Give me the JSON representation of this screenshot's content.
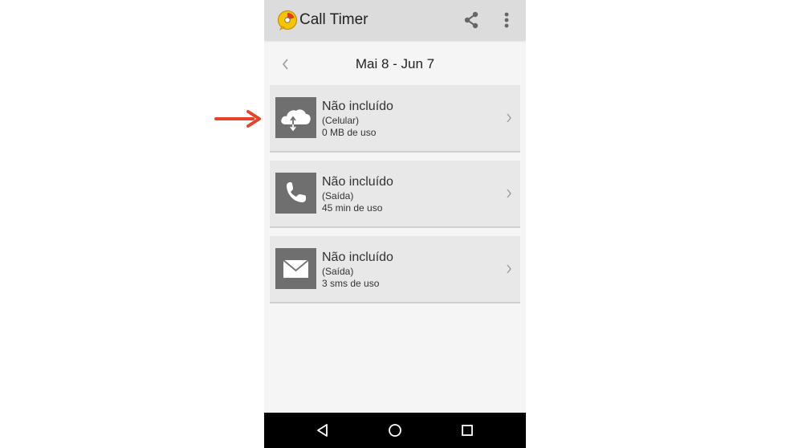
{
  "app": {
    "title": "Call Timer",
    "icon": "call-timer-logo-icon",
    "share_icon": "share-icon",
    "menu_icon": "overflow-menu-icon"
  },
  "date_nav": {
    "range": "Mai 8 - Jun 7",
    "prev_icon": "chevron-left-icon"
  },
  "cards": [
    {
      "title": "Não incluído",
      "subtitle": "(Celular)",
      "usage": "0 MB de uso",
      "icon": "cloud-data-icon"
    },
    {
      "title": "Não incluído",
      "subtitle": "(Saída)",
      "usage": "45 min de uso",
      "icon": "phone-icon"
    },
    {
      "title": "Não incluído",
      "subtitle": "(Saída)",
      "usage": "3 sms de uso",
      "icon": "envelope-icon"
    }
  ],
  "colors": {
    "appbar": "#dcdcdc",
    "background": "#f5f5f5",
    "card": "#e8e8e8",
    "icon_tile": "#6f6f6f",
    "pointer_arrow": "#e8432a",
    "navbar": "#000000"
  },
  "navbar": {
    "back_icon": "back-triangle-icon",
    "home_icon": "home-circle-icon",
    "recents_icon": "recents-square-icon"
  }
}
